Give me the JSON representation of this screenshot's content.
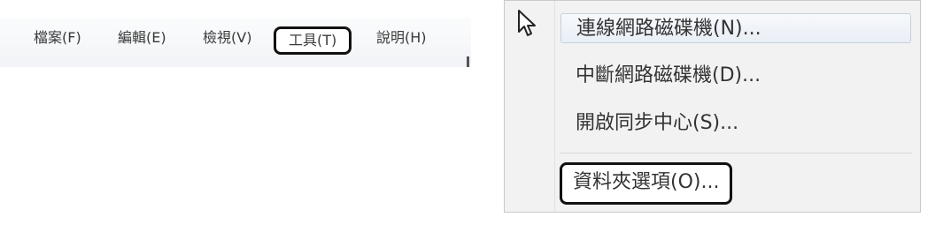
{
  "menubar": {
    "items": [
      {
        "label": "檔案(F)"
      },
      {
        "label": "編輯(E)"
      },
      {
        "label": "檢視(V)"
      },
      {
        "label": "工具(T)"
      },
      {
        "label": "說明(H)"
      }
    ]
  },
  "tools_menu": {
    "items": [
      {
        "label": "連線網路磁碟機(N)..."
      },
      {
        "label": "中斷網路磁碟機(D)..."
      },
      {
        "label": "開啟同步中心(S)..."
      },
      {
        "label": "資料夾選項(O)..."
      }
    ]
  },
  "icons": {
    "cursor": "mouse-pointer-icon"
  },
  "colors": {
    "highlight_border": "#111111",
    "hover_row": "#e9eef6",
    "menubar_bg": "#f3f5f8"
  }
}
